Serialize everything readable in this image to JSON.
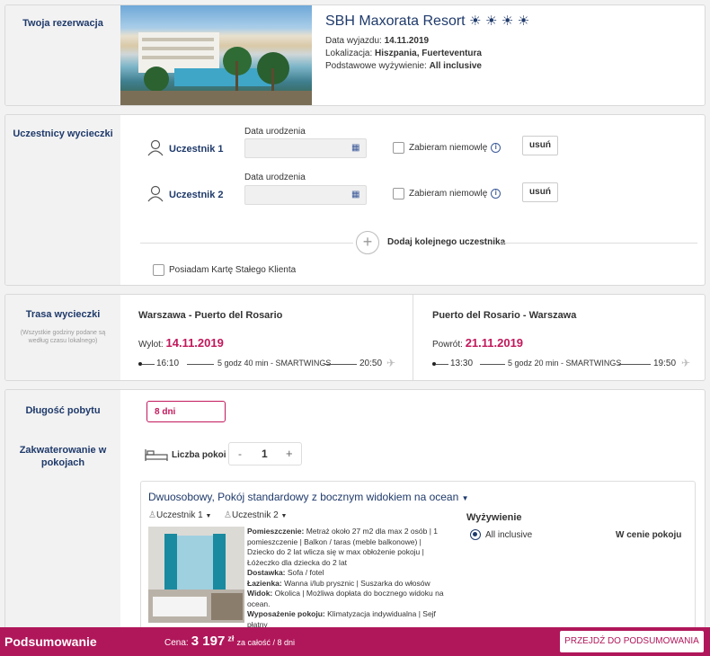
{
  "reservation": {
    "section_title": "Twoja rezerwacja",
    "hotel_name": "SBH Maxorata Resort",
    "stars": [
      "☀",
      "☀",
      "☀",
      "☀"
    ],
    "departure_label": "Data wyjazdu:",
    "departure_value": "14.11.2019",
    "location_label": "Lokalizacja:",
    "location_value": "Hiszpania, Fuerteventura",
    "board_label": "Podstawowe wyżywienie:",
    "board_value": "All inclusive"
  },
  "participants": {
    "section_title": "Uczestnicy wycieczki",
    "birth_label": "Data urodzenia",
    "items": [
      {
        "name": "Uczestnik 1",
        "infant": "Zabieram niemowlę",
        "remove": "usuń"
      },
      {
        "name": "Uczestnik 2",
        "infant": "Zabieram niemowlę",
        "remove": "usuń"
      }
    ],
    "add_label": "Dodaj kolejnego uczestnika",
    "loyalty_label": "Posiadam Kartę Stałego Klienta"
  },
  "route": {
    "section_title": "Trasa wycieczki",
    "section_note": "(Wszystkie godziny podane są według czasu lokalnego)",
    "outbound": {
      "title": "Warszawa - Puerto del Rosario",
      "date_label": "Wylot:",
      "date_value": "14.11.2019",
      "dep_time": "16:10",
      "duration": "5 godz 40 min - SMARTWINGS",
      "arr_time": "20:50"
    },
    "inbound": {
      "title": "Puerto del Rosario - Warszawa",
      "date_label": "Powrót:",
      "date_value": "21.11.2019",
      "dep_time": "13:30",
      "duration": "5 godz 20 min - SMARTWINGS",
      "arr_time": "19:50"
    }
  },
  "stay": {
    "section_title": "Długość pobytu",
    "length_value": "8 dni",
    "rooms_section_title": "Zakwaterowanie w pokojach",
    "rooms_label": "Liczba pokoi",
    "rooms_count": "1",
    "minus": "-",
    "plus": "+",
    "room_title": "Dwuosobowy, Pokój standardowy z bocznym widokiem na ocean",
    "room_participants": [
      "Uczestnik 1",
      "Uczestnik 2"
    ],
    "details": [
      {
        "label": "Pomieszczenie:",
        "text": "Metraż około 27 m2 dla max 2 osób | 1 pomieszczenie | Balkon / taras (meble balkonowe) | Dziecko do 2 lat wlicza się w max obłożenie pokoju | Łóżeczko dla dziecka do 2 lat"
      },
      {
        "label": "Dostawka:",
        "text": "Sofa / fotel"
      },
      {
        "label": "Łazienka:",
        "text": "Wanna i/lub prysznic | Suszarka do włosów"
      },
      {
        "label": "Widok:",
        "text": "Okolica | Możliwa dopłata do bocznego widoku na ocean."
      },
      {
        "label": "Wyposażenie pokoju:",
        "text": "Klimatyzacja indywidualna | Sejf płatny"
      }
    ],
    "board_title": "Wyżywienie",
    "board_option": "All inclusive",
    "board_price": "W cenie pokoju"
  },
  "footer": {
    "title": "Podsumowanie",
    "price_label": "Cena:",
    "price_value": "3 197",
    "currency": "zł",
    "price_note": "za całość / 8 dni",
    "cta": "PRZEJDŹ DO PODSUMOWANIA"
  }
}
